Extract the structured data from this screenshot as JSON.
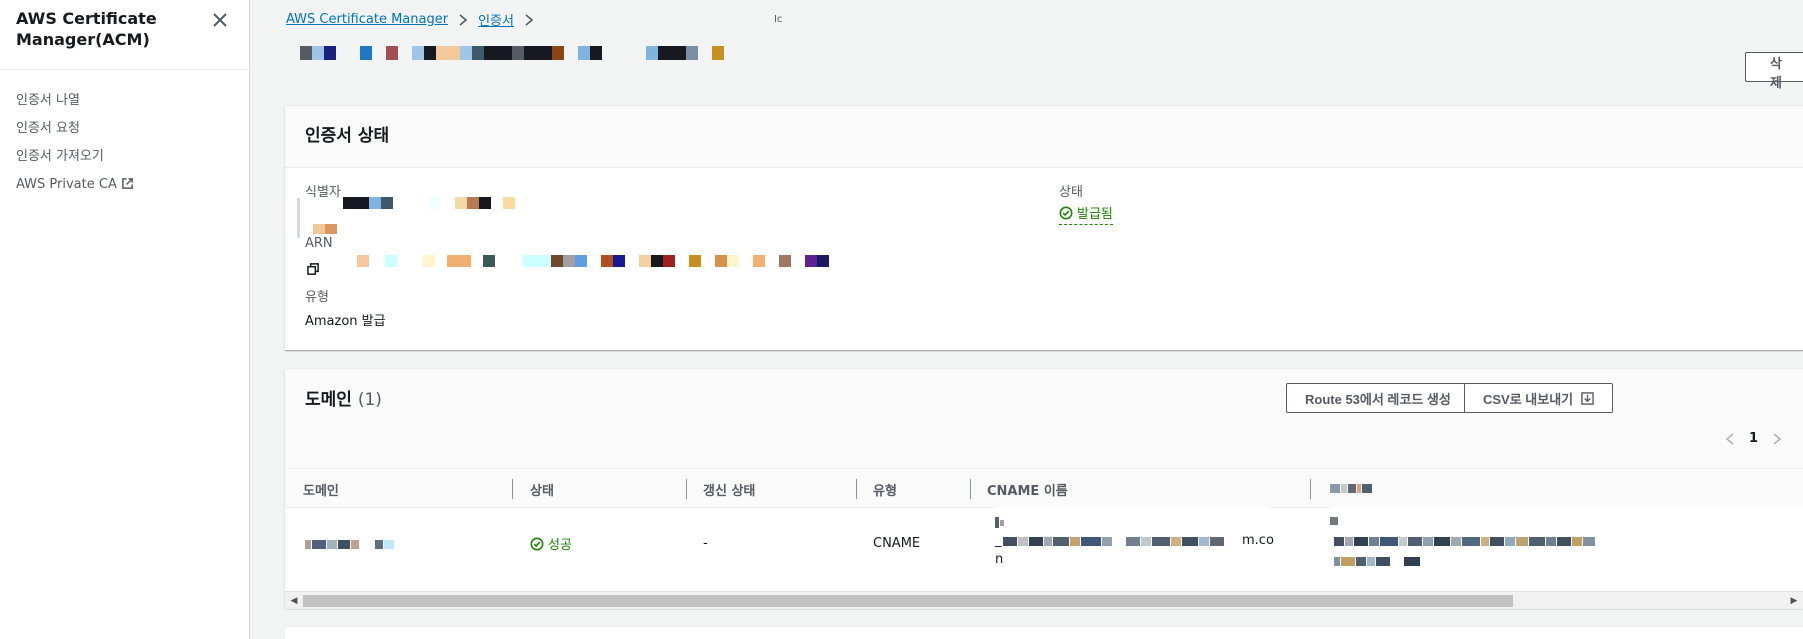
{
  "sidebar": {
    "title": "AWS Certificate Manager(ACM)",
    "items": [
      {
        "label": "인증서 나열"
      },
      {
        "label": "인증서 요청"
      },
      {
        "label": "인증서 가져오기"
      },
      {
        "label": "AWS Private CA"
      }
    ]
  },
  "breadcrumb": {
    "root": "AWS Certificate Manager",
    "level2": "인증서",
    "current": "Ic"
  },
  "header": {
    "delete_label": "삭제"
  },
  "status_panel": {
    "title": "인증서 상태",
    "id_label": "식별자",
    "arn_label": "ARN",
    "type_label": "유형",
    "type_value": "Amazon 발급",
    "status_label": "상태",
    "status_value": "발급됨"
  },
  "domain_panel": {
    "title": "도메인",
    "count": "(1)",
    "route53_label": "Route 53에서 레코드 생성",
    "csv_label": "CSV로 내보내기",
    "page": "1",
    "columns": [
      "도메인",
      "상태",
      "갱신 상태",
      "유형",
      "CNAME 이름"
    ],
    "rows": [
      {
        "status": "성공",
        "renewal": "-",
        "type": "CNAME",
        "cname_tail": "m.co",
        "cname_tail2": "n",
        "cname_prefix": "_"
      }
    ]
  },
  "colors": {
    "accent": "#0073bb",
    "success": "#1d8102",
    "text": "#16191f",
    "muted": "#545b64"
  }
}
